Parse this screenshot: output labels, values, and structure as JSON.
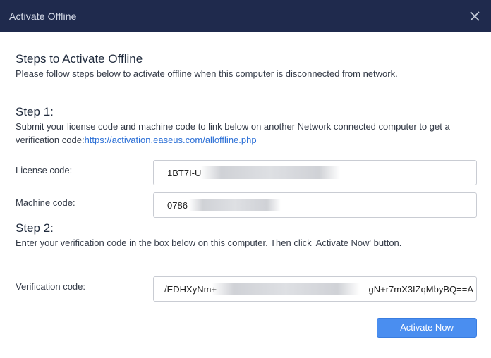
{
  "window": {
    "title": "Activate Offline",
    "close_icon": "close-icon"
  },
  "intro": {
    "heading": "Steps to Activate Offline",
    "text": "Please follow steps below to activate offline when this computer is disconnected from network."
  },
  "step1": {
    "heading": "Step 1:",
    "text": "Submit your license code and machine code to link below on another Network connected computer to get a verification code:",
    "link": "https://activation.easeus.com/alloffline.php"
  },
  "fields": {
    "license": {
      "label": "License code:",
      "value": "1BT7I-U"
    },
    "machine": {
      "label": "Machine code:",
      "value": "0786"
    },
    "verification": {
      "label": "Verification code:",
      "value_start": "/EDHXyNm+",
      "value_end": "gN+r7mX3IZqMbyBQ==A"
    }
  },
  "step2": {
    "heading": "Step 2:",
    "text": "Enter your verification code in the box below on this computer. Then click 'Activate Now' button."
  },
  "actions": {
    "activate_label": "Activate Now"
  },
  "colors": {
    "titlebar": "#1f2a4d",
    "accent": "#4a8ef0",
    "link": "#2b6fd6"
  }
}
